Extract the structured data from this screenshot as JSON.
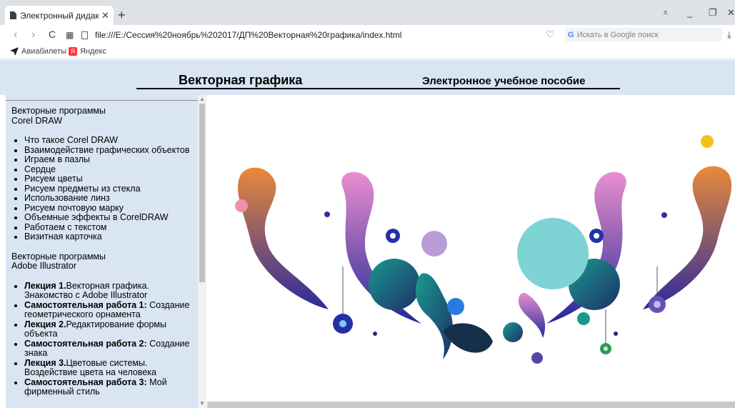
{
  "browser": {
    "tab_title": "Электронный дидактичес",
    "url": "file:///E:/Сессия%20ноябрь%202017/ДП%20Векторная%20графика/index.html",
    "search_placeholder": "Искать в Google поиск",
    "bookmarks": [
      "Авиабилеты",
      "Яндекс"
    ]
  },
  "header": {
    "title": "Векторная графика",
    "subtitle": "Электронное учебное пособие"
  },
  "sidebar": {
    "section1_line1": "Векторные программы",
    "section1_line2": "Corel DRAW",
    "corel_items": [
      "Что такое Corel DRAW",
      "Взаимодействие графических объектов",
      "Играем в пазлы",
      "Сердце",
      "Рисуем цветы",
      "Рисуем предметы из стекла",
      "Использование линз",
      "Рисуем почтовую марку",
      "Объемные эффекты в CorelDRAW",
      "Работаем с текстом",
      "Визитная карточка"
    ],
    "section2_line1": "Векторные программы",
    "section2_line2": "Adobe Illustrator",
    "ai_items": [
      {
        "bold": "Лекция 1.",
        "text": "Векторная графика. Знакомство с Adobe Illustrator"
      },
      {
        "bold": "Самостоятельная работа 1:",
        "text": " Создание геометрического орнамента"
      },
      {
        "bold": "Лекция 2.",
        "text": "Редактирование формы объекта"
      },
      {
        "bold": "Самостоятельная работа 2:",
        "text": " Создание знака"
      },
      {
        "bold": "Лекция 3.",
        "text": "Цветовые системы. Воздействие цвета на человека"
      },
      {
        "bold": "Самостоятельная работа 3:",
        "text": " Мой фирменный стиль"
      }
    ]
  },
  "colors": {
    "page_bg": "#d9e5f3",
    "accent_teal": "#1b7c87",
    "accent_blue": "#2430a8",
    "accent_pink": "#e884c4",
    "accent_yellow": "#f6c11e"
  }
}
